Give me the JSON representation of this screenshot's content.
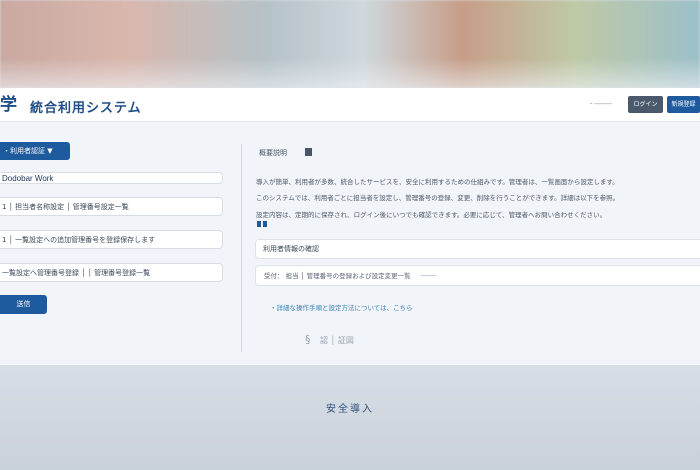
{
  "header": {
    "logo_glyph": "学",
    "title": "統合利用システム",
    "link": "・─────",
    "btn_gray": "ログイン",
    "btn_blue": "新規登録"
  },
  "left": {
    "pill": "・利用者認証 ▼",
    "field1": "Dodobar Work",
    "field2": "1 │ 担当者名称設定 │ 管理番号設定一覧",
    "field3": "1 │ 一覧設定への追加管理番号を登録保存します",
    "field4": "一覧設定へ管理番号登録 │ │ 管理番号登録一覧",
    "submit": "送信"
  },
  "right": {
    "section_title": "概要説明",
    "text1": "導入が簡単、利用者が多数、統合したサービスを、安全に利用するための仕組みです。管理者は、一覧画面から設定します。",
    "text2": "このシステムでは、利用者ごとに担当者を設定し、管理番号の登録、変更、削除を行うことができます。詳細は以下を参照。",
    "text3": "設定内容は、定期的に保存され、ログイン後にいつでも確認できます。必要に応じて、管理者へお問い合わせください。",
    "card1": "利用者情報の確認",
    "card2": "受付： 担当 │ 管理番号の登録および設定変更一覧",
    "card2_tail": "────",
    "link": "・詳細な操作手順と設定方法については、こちら",
    "sig_glyph": "§",
    "sig_text": "認 │ 証図"
  },
  "footer": {
    "text": "安全導入"
  }
}
